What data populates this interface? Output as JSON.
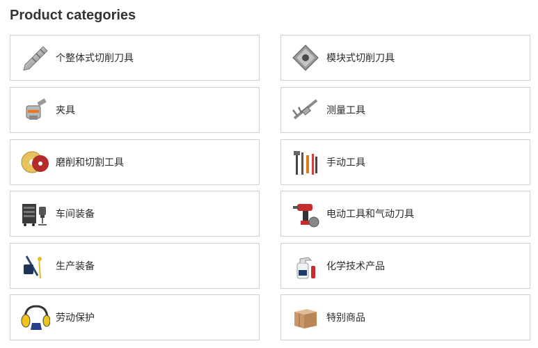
{
  "section": {
    "title": "Product categories"
  },
  "categories": [
    {
      "label": "个整体式切削刀具",
      "icon": "drill-bit-icon"
    },
    {
      "label": "模块式切削刀具",
      "icon": "insert-icon"
    },
    {
      "label": "夹具",
      "icon": "collet-chuck-icon"
    },
    {
      "label": "测量工具",
      "icon": "caliper-icon"
    },
    {
      "label": "磨削和切割工具",
      "icon": "grinding-disc-icon"
    },
    {
      "label": "手动工具",
      "icon": "hand-tools-icon"
    },
    {
      "label": "车间装备",
      "icon": "workshop-cabinet-icon"
    },
    {
      "label": "电动工具和气动刀具",
      "icon": "power-drill-icon"
    },
    {
      "label": "生产装备",
      "icon": "production-equipment-icon"
    },
    {
      "label": "化学技术产品",
      "icon": "spray-bottle-icon"
    },
    {
      "label": "劳动保护",
      "icon": "ear-protection-icon"
    },
    {
      "label": "特别商品",
      "icon": "box-icon"
    }
  ]
}
